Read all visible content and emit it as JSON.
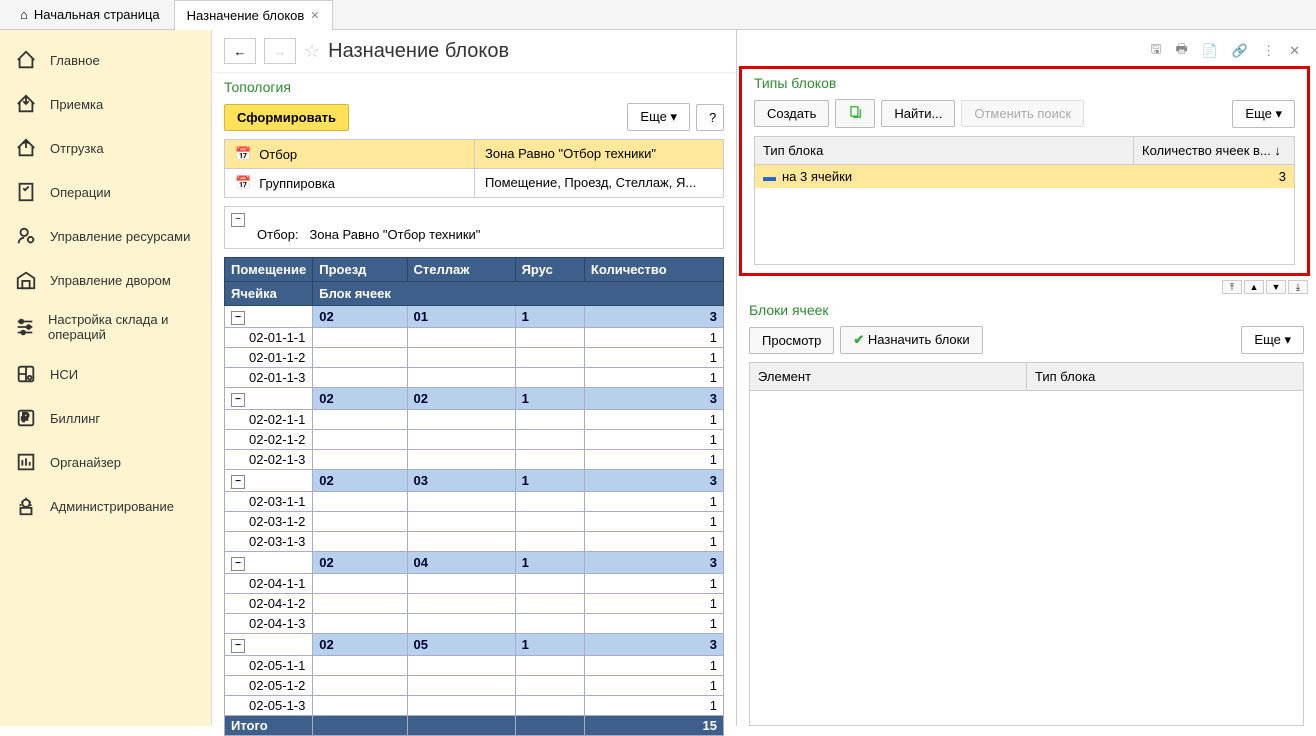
{
  "tabs": {
    "home": "Начальная страница",
    "active": "Назначение блоков"
  },
  "sidebar": {
    "items": [
      {
        "label": "Главное"
      },
      {
        "label": "Приемка"
      },
      {
        "label": "Отгрузка"
      },
      {
        "label": "Операции"
      },
      {
        "label": "Управление ресурсами"
      },
      {
        "label": "Управление двором"
      },
      {
        "label": "Настройка склада и операций"
      },
      {
        "label": "НСИ"
      },
      {
        "label": "Биллинг"
      },
      {
        "label": "Органайзер"
      },
      {
        "label": "Администрирование"
      }
    ]
  },
  "page": {
    "title": "Назначение блоков"
  },
  "left": {
    "section": "Топология",
    "form_btn": "Сформировать",
    "more_btn": "Еще",
    "help_btn": "?",
    "filter_label": "Отбор",
    "filter_value": "Зона Равно \"Отбор техники\"",
    "group_label": "Группировка",
    "group_value": "Помещение, Проезд, Стеллаж, Я...",
    "filter_caption": "Отбор:",
    "filter_text": "Зона Равно \"Отбор техники\"",
    "headers": {
      "room": "Помещение",
      "aisle": "Проезд",
      "rack": "Стеллаж",
      "tier": "Ярус",
      "qty": "Количество",
      "cell": "Ячейка",
      "block": "Блок ячеек"
    },
    "groups": [
      {
        "room": "02",
        "aisle": "01",
        "rack": "1",
        "qty": "3",
        "cells": [
          "02-01-1-1",
          "02-01-1-2",
          "02-01-1-3"
        ]
      },
      {
        "room": "02",
        "aisle": "02",
        "rack": "1",
        "qty": "3",
        "cells": [
          "02-02-1-1",
          "02-02-1-2",
          "02-02-1-3"
        ]
      },
      {
        "room": "02",
        "aisle": "03",
        "rack": "1",
        "qty": "3",
        "cells": [
          "02-03-1-1",
          "02-03-1-2",
          "02-03-1-3"
        ]
      },
      {
        "room": "02",
        "aisle": "04",
        "rack": "1",
        "qty": "3",
        "cells": [
          "02-04-1-1",
          "02-04-1-2",
          "02-04-1-3"
        ]
      },
      {
        "room": "02",
        "aisle": "05",
        "rack": "1",
        "qty": "3",
        "cells": [
          "02-05-1-1",
          "02-05-1-2",
          "02-05-1-3"
        ]
      }
    ],
    "cell_qty": "1",
    "total_label": "Итого",
    "total_qty": "15"
  },
  "right": {
    "types_title": "Типы блоков",
    "create_btn": "Создать",
    "find_btn": "Найти...",
    "cancel_search_btn": "Отменить поиск",
    "more_btn": "Еще",
    "col_type": "Тип блока",
    "col_cells": "Количество ячеек в...",
    "row_type": "на 3 ячейки",
    "row_cells": "3",
    "blocks_title": "Блоки ячеек",
    "view_btn": "Просмотр",
    "assign_btn": "Назначить блоки",
    "col_element": "Элемент",
    "col_block_type": "Тип блока"
  }
}
